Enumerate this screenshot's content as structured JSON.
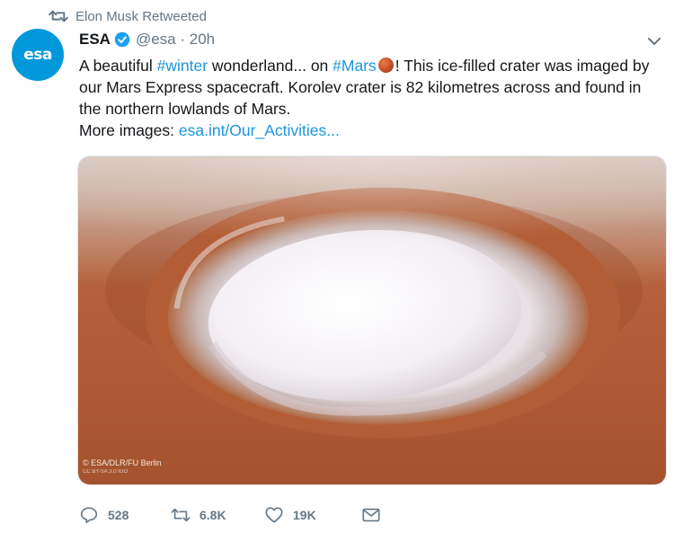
{
  "retweet_banner": {
    "text": "Elon Musk Retweeted"
  },
  "tweet": {
    "author_name": "ESA",
    "avatar_text": "esa",
    "handle_time": "@esa · 20h",
    "text_1": "A beautiful ",
    "hashtag_1": "#winter",
    "text_2": " wonderland... on ",
    "hashtag_2": "#Mars",
    "text_3": "! This ice-filled crater was imaged by our Mars Express spacecraft. Korolev crater is 82 kilometres across and found in the northern lowlands of Mars.",
    "more_label": "More images: ",
    "link": "esa.int/Our_Activities..."
  },
  "media": {
    "credit_line1": "© ESA/DLR/FU Berlin",
    "credit_line2": "CC BY-SA 3.0 IGO"
  },
  "actions": {
    "replies": "528",
    "retweets": "6.8K",
    "likes": "19K"
  },
  "colors": {
    "link": "#1b95e0",
    "muted": "#657786",
    "avatar_bg": "#0098db"
  },
  "icons": [
    "retweet-icon",
    "verified-badge-icon",
    "chevron-down-icon",
    "reply-icon",
    "like-icon",
    "message-icon",
    "mars-emoji"
  ]
}
